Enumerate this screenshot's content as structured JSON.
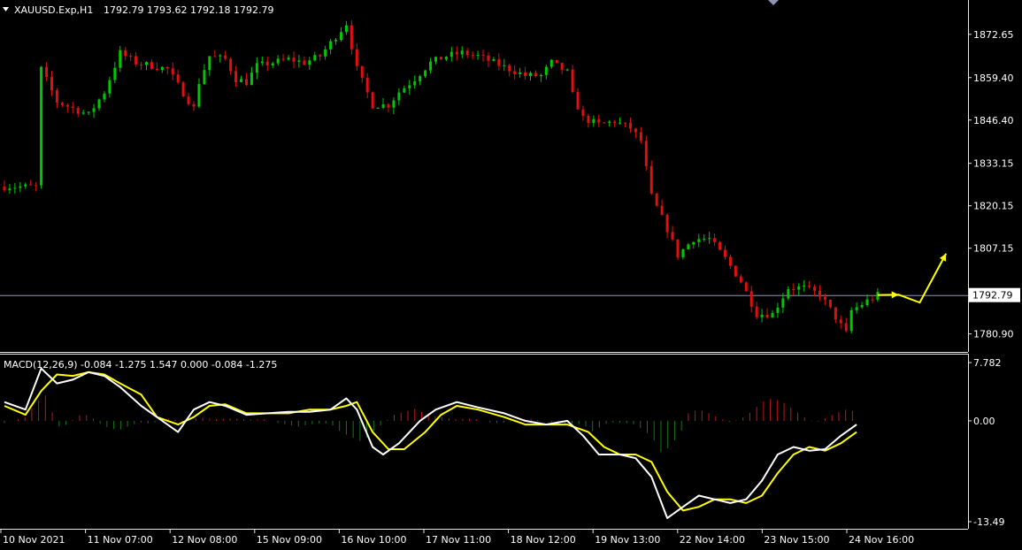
{
  "header": {
    "symbol": "XAUUSD.Exp,H1",
    "ohlc": "1792.79 1793.62 1792.18 1792.79"
  },
  "indicator": {
    "label": "MACD(12,26,9) -0.084 -1.275 1.547 0.000 -0.084 -1.275"
  },
  "colors": {
    "background": "#000000",
    "bull": "#00c800",
    "bear": "#e01010",
    "macd_line": "#ffffff",
    "signal_line": "#ffff00",
    "hist_pos": "#c01818",
    "hist_neg": "#147814",
    "arrow": "#ffff00",
    "price_line": "#8c96b4"
  },
  "chart_data": [
    {
      "type": "candlestick",
      "title": "XAUUSD.Exp,H1",
      "price_axis_ticks": [
        "1872.65",
        "1859.40",
        "1846.40",
        "1833.15",
        "1820.15",
        "1807.15",
        "1780.90"
      ],
      "price_axis_values": [
        1872.65,
        1859.4,
        1846.4,
        1833.15,
        1820.15,
        1807.15,
        1780.9
      ],
      "current_price_label": "1792.79",
      "current_price": 1792.79,
      "ylim": [
        1777.0,
        1881.0
      ],
      "time_labels": [
        "10 Nov 2021",
        "11 Nov 07:00",
        "12 Nov 08:00",
        "15 Nov 09:00",
        "16 Nov 10:00",
        "17 Nov 11:00",
        "18 Nov 12:00",
        "19 Nov 13:00",
        "22 Nov 14:00",
        "23 Nov 15:00",
        "24 Nov 16:00"
      ],
      "close_path": [
        [
          0,
          1826
        ],
        [
          6,
          1826
        ],
        [
          7,
          1862
        ],
        [
          10,
          1852
        ],
        [
          13,
          1850
        ],
        [
          16,
          1848
        ],
        [
          19,
          1855
        ],
        [
          21,
          1863
        ],
        [
          22,
          1867
        ],
        [
          25,
          1864
        ],
        [
          28,
          1863
        ],
        [
          31,
          1862
        ],
        [
          33,
          1857
        ],
        [
          36,
          1850
        ],
        [
          37,
          1858
        ],
        [
          39,
          1866
        ],
        [
          42,
          1865
        ],
        [
          44,
          1859
        ],
        [
          46,
          1858
        ],
        [
          48,
          1863
        ],
        [
          51,
          1864
        ],
        [
          54,
          1865
        ],
        [
          57,
          1864
        ],
        [
          60,
          1866
        ],
        [
          62,
          1870
        ],
        [
          65,
          1876
        ],
        [
          67,
          1862
        ],
        [
          70,
          1851
        ],
        [
          73,
          1851
        ],
        [
          75,
          1855
        ],
        [
          78,
          1859
        ],
        [
          81,
          1864
        ],
        [
          84,
          1866
        ],
        [
          87,
          1867
        ],
        [
          90,
          1866
        ],
        [
          93,
          1864
        ],
        [
          96,
          1862
        ],
        [
          99,
          1860
        ],
        [
          102,
          1860
        ],
        [
          104,
          1864
        ],
        [
          107,
          1861
        ],
        [
          108,
          1854
        ],
        [
          110,
          1847
        ],
        [
          113,
          1845
        ],
        [
          116,
          1846
        ],
        [
          119,
          1844
        ],
        [
          121,
          1840
        ],
        [
          123,
          1823
        ],
        [
          126,
          1813
        ],
        [
          128,
          1805
        ],
        [
          131,
          1810
        ],
        [
          134,
          1810
        ],
        [
          137,
          1804
        ],
        [
          140,
          1797
        ],
        [
          143,
          1787
        ],
        [
          146,
          1787
        ],
        [
          149,
          1795
        ],
        [
          152,
          1795
        ],
        [
          155,
          1793
        ],
        [
          158,
          1786
        ],
        [
          160,
          1781
        ],
        [
          161,
          1788
        ],
        [
          164,
          1791
        ],
        [
          166,
          1792.8
        ]
      ],
      "macd": {
        "ylim": [
          -14.2,
          8.5
        ],
        "axis_ticks": [
          "7.782",
          "0.00",
          "-13.49"
        ],
        "axis_values": [
          7.782,
          0.0,
          -13.49
        ],
        "main": [
          [
            0,
            2.5
          ],
          [
            4,
            1.5
          ],
          [
            7,
            7.0
          ],
          [
            10,
            5.0
          ],
          [
            13,
            5.5
          ],
          [
            16,
            6.5
          ],
          [
            19,
            6.0
          ],
          [
            22,
            4.5
          ],
          [
            26,
            2.0
          ],
          [
            29,
            0.5
          ],
          [
            33,
            -1.5
          ],
          [
            36,
            1.5
          ],
          [
            39,
            2.5
          ],
          [
            42,
            2.0
          ],
          [
            46,
            0.8
          ],
          [
            50,
            1.0
          ],
          [
            54,
            1.2
          ],
          [
            58,
            1.2
          ],
          [
            62,
            1.5
          ],
          [
            65,
            3.0
          ],
          [
            67,
            1.5
          ],
          [
            70,
            -3.5
          ],
          [
            72,
            -4.5
          ],
          [
            75,
            -3.0
          ],
          [
            79,
            0.0
          ],
          [
            82,
            1.5
          ],
          [
            86,
            2.5
          ],
          [
            90,
            1.8
          ],
          [
            95,
            1.0
          ],
          [
            99,
            0.0
          ],
          [
            103,
            -0.5
          ],
          [
            107,
            0.0
          ],
          [
            110,
            -2.0
          ],
          [
            113,
            -4.5
          ],
          [
            117,
            -4.5
          ],
          [
            120,
            -5.0
          ],
          [
            123,
            -7.5
          ],
          [
            126,
            -13.0
          ],
          [
            129,
            -11.5
          ],
          [
            132,
            -10.0
          ],
          [
            135,
            -10.5
          ],
          [
            138,
            -11.0
          ],
          [
            141,
            -10.5
          ],
          [
            144,
            -8.0
          ],
          [
            147,
            -4.5
          ],
          [
            150,
            -3.5
          ],
          [
            153,
            -4.0
          ],
          [
            156,
            -3.8
          ],
          [
            159,
            -2.0
          ],
          [
            162,
            -0.5
          ]
        ],
        "signal": [
          [
            0,
            2.0
          ],
          [
            4,
            0.8
          ],
          [
            7,
            4.0
          ],
          [
            10,
            6.2
          ],
          [
            13,
            6.0
          ],
          [
            16,
            6.5
          ],
          [
            19,
            6.2
          ],
          [
            22,
            5.0
          ],
          [
            26,
            3.5
          ],
          [
            29,
            0.5
          ],
          [
            33,
            -0.5
          ],
          [
            36,
            0.5
          ],
          [
            39,
            2.0
          ],
          [
            42,
            2.2
          ],
          [
            46,
            1.0
          ],
          [
            50,
            1.0
          ],
          [
            54,
            1.0
          ],
          [
            58,
            1.5
          ],
          [
            62,
            1.5
          ],
          [
            65,
            2.0
          ],
          [
            67,
            2.5
          ],
          [
            70,
            -1.5
          ],
          [
            73,
            -3.8
          ],
          [
            76,
            -3.8
          ],
          [
            80,
            -1.5
          ],
          [
            83,
            0.8
          ],
          [
            86,
            2.0
          ],
          [
            90,
            1.5
          ],
          [
            95,
            0.5
          ],
          [
            99,
            -0.5
          ],
          [
            103,
            -0.5
          ],
          [
            107,
            -0.5
          ],
          [
            111,
            -1.5
          ],
          [
            114,
            -3.5
          ],
          [
            117,
            -4.5
          ],
          [
            120,
            -4.5
          ],
          [
            123,
            -5.5
          ],
          [
            126,
            -9.5
          ],
          [
            129,
            -12.0
          ],
          [
            132,
            -11.5
          ],
          [
            135,
            -10.5
          ],
          [
            138,
            -10.5
          ],
          [
            141,
            -11.0
          ],
          [
            144,
            -10.0
          ],
          [
            147,
            -7.0
          ],
          [
            150,
            -4.5
          ],
          [
            153,
            -3.5
          ],
          [
            156,
            -4.0
          ],
          [
            159,
            -3.0
          ],
          [
            162,
            -1.5
          ]
        ],
        "histogram": [
          [
            0,
            -0.3
          ],
          [
            4,
            0.5
          ],
          [
            6,
            2.5
          ],
          [
            8,
            3.5
          ],
          [
            10,
            -0.8
          ],
          [
            12,
            -0.5
          ],
          [
            14,
            0.7
          ],
          [
            16,
            0.8
          ],
          [
            18,
            -0.3
          ],
          [
            20,
            -1.0
          ],
          [
            22,
            -1.2
          ],
          [
            24,
            -0.6
          ],
          [
            26,
            -0.2
          ],
          [
            28,
            -0.4
          ],
          [
            30,
            0.2
          ],
          [
            32,
            0.3
          ],
          [
            34,
            -0.3
          ],
          [
            36,
            0.3
          ],
          [
            38,
            0.4
          ],
          [
            40,
            0.2
          ],
          [
            42,
            0.3
          ],
          [
            44,
            0.3
          ],
          [
            46,
            0.2
          ],
          [
            48,
            0.2
          ],
          [
            50,
            0.2
          ],
          [
            52,
            -0.3
          ],
          [
            54,
            -0.5
          ],
          [
            56,
            -0.8
          ],
          [
            58,
            -0.5
          ],
          [
            60,
            -0.3
          ],
          [
            62,
            -0.4
          ],
          [
            64,
            -1.5
          ],
          [
            66,
            -2.2
          ],
          [
            68,
            -2.8
          ],
          [
            70,
            -1.5
          ],
          [
            72,
            -0.3
          ],
          [
            74,
            0.8
          ],
          [
            76,
            1.2
          ],
          [
            78,
            1.6
          ],
          [
            80,
            1.0
          ],
          [
            82,
            0.6
          ],
          [
            84,
            0.4
          ],
          [
            86,
            0.2
          ],
          [
            88,
            0.3
          ],
          [
            90,
            0.2
          ],
          [
            92,
            -0.2
          ],
          [
            94,
            -0.3
          ],
          [
            96,
            -0.2
          ],
          [
            98,
            0.2
          ],
          [
            100,
            0.3
          ],
          [
            102,
            0.1
          ],
          [
            104,
            -0.2
          ],
          [
            106,
            -0.4
          ],
          [
            108,
            -0.3
          ],
          [
            110,
            -0.5
          ],
          [
            112,
            -1.5
          ],
          [
            114,
            -0.4
          ],
          [
            116,
            -0.2
          ],
          [
            118,
            -0.3
          ],
          [
            120,
            -0.5
          ],
          [
            122,
            -1.5
          ],
          [
            124,
            -3.0
          ],
          [
            125,
            -4.5
          ],
          [
            127,
            -3.0
          ],
          [
            129,
            -1.0
          ],
          [
            130,
            1.0
          ],
          [
            132,
            1.5
          ],
          [
            134,
            1.0
          ],
          [
            136,
            0.3
          ],
          [
            138,
            -0.2
          ],
          [
            140,
            0.3
          ],
          [
            142,
            1.2
          ],
          [
            144,
            2.5
          ],
          [
            146,
            3.0
          ],
          [
            148,
            2.5
          ],
          [
            150,
            1.5
          ],
          [
            152,
            0.5
          ],
          [
            154,
            -0.3
          ],
          [
            156,
            0.3
          ],
          [
            158,
            1.0
          ],
          [
            160,
            1.5
          ],
          [
            162,
            1.2
          ]
        ]
      },
      "projection_arrow": [
        [
          166,
          1792.8
        ],
        [
          170,
          1792.9
        ],
        [
          174,
          1790.5
        ],
        [
          179,
          1805.5
        ]
      ]
    }
  ]
}
